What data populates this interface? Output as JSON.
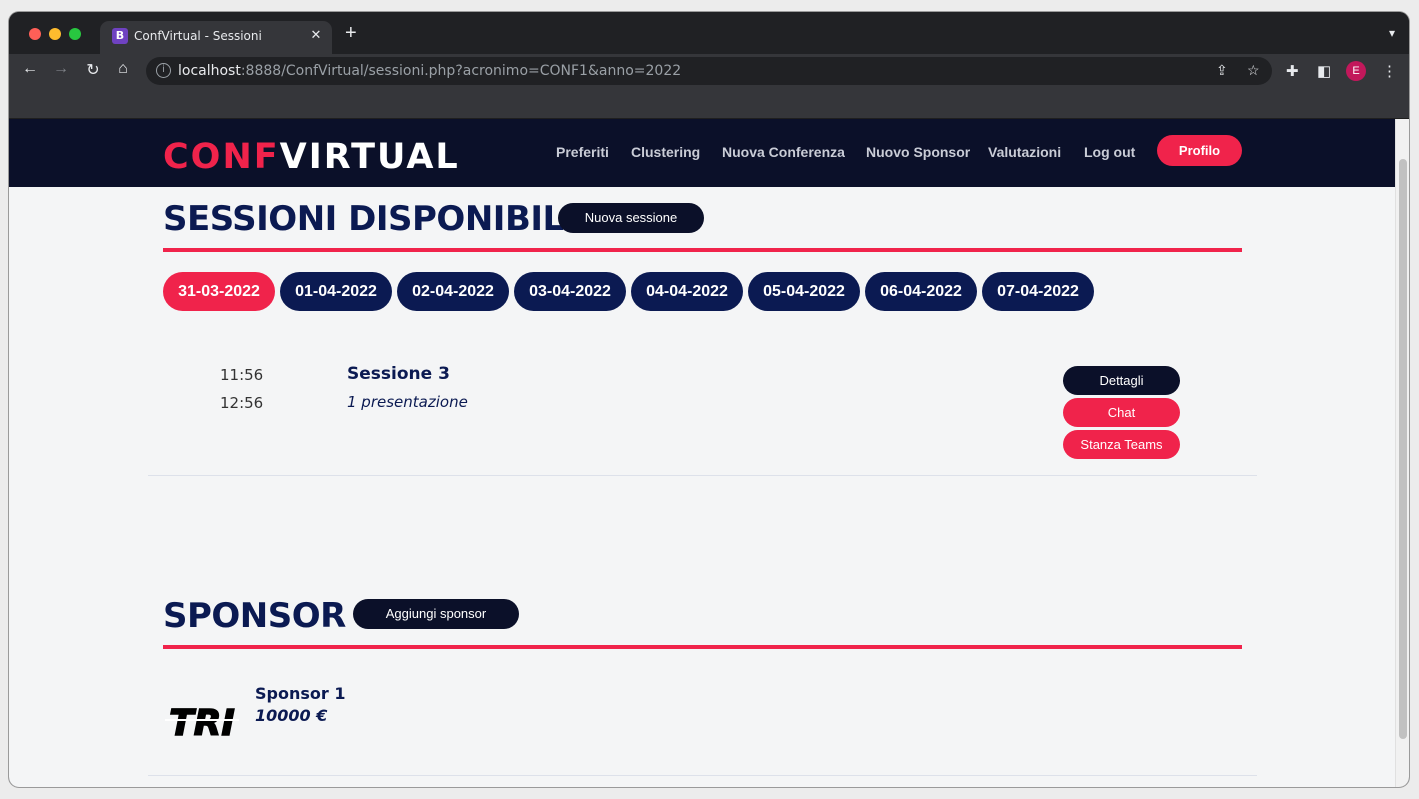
{
  "browser": {
    "tab_favicon": "B",
    "tab_title": "ConfVirtual - Sessioni",
    "url_host": "localhost",
    "url_rest": ":8888/ConfVirtual/sessioni.php?acronimo=CONF1&anno=2022",
    "avatar_initial": "E"
  },
  "navbar": {
    "logo_part1": "CONF",
    "logo_part2": "VIRTUAL",
    "links": [
      "Preferiti",
      "Clustering",
      "Nuova Conferenza",
      "Nuovo Sponsor",
      "Valutazioni",
      "Log out"
    ],
    "profile_label": "Profilo"
  },
  "sessions": {
    "title": "SESSIONI DISPONIBILI",
    "new_button": "Nuova sessione",
    "dates": [
      "31-03-2022",
      "01-04-2022",
      "02-04-2022",
      "03-04-2022",
      "04-04-2022",
      "05-04-2022",
      "06-04-2022",
      "07-04-2022"
    ],
    "active_date": "31-03-2022",
    "items": [
      {
        "start": "11:56",
        "end": "12:56",
        "name": "Sessione 3",
        "subtitle": "1 presentazione",
        "buttons": [
          "Dettagli",
          "Chat",
          "Stanza Teams"
        ]
      }
    ]
  },
  "sponsors": {
    "title": "SPONSOR",
    "add_button": "Aggiungi sponsor",
    "items": [
      {
        "logo_text": "TRI",
        "name": "Sponsor 1",
        "amount": "10000 €"
      }
    ]
  },
  "colors": {
    "accent": "#f0234b",
    "navy": "#0b1a52",
    "navbar": "#0b1029"
  }
}
